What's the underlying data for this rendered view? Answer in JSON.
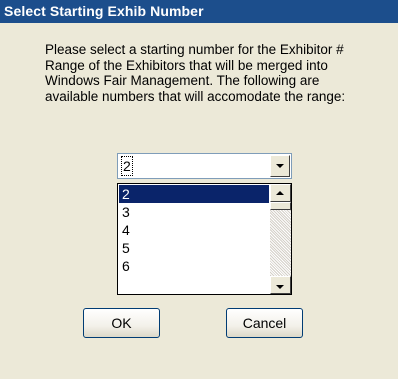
{
  "window": {
    "title": "Select Starting Exhib Number"
  },
  "message": "Please select a starting number for the Exhibitor # Range of the Exhibitors that will be merged into Windows Fair Management.  The following are available numbers that will accomodate the range:",
  "combo": {
    "selected_value": "2",
    "icon": "chevron-down-icon"
  },
  "list": {
    "items": [
      "2",
      "3",
      "4",
      "5",
      "6"
    ],
    "selected_index": 0,
    "scroll_position": 0
  },
  "buttons": {
    "ok_label": "OK",
    "cancel_label": "Cancel"
  },
  "colors": {
    "title_bar": "#1c4e8c",
    "selection": "#0a246a",
    "dialog_bg": "#ece9d8"
  }
}
